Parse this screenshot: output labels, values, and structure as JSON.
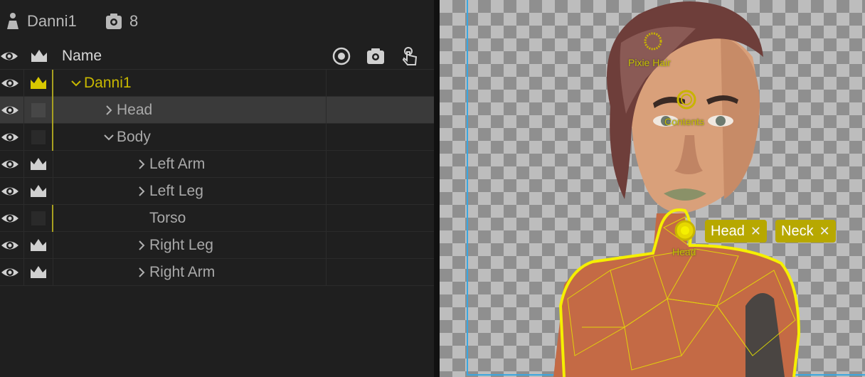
{
  "header": {
    "puppet_name": "Danni1",
    "count": "8"
  },
  "columns": {
    "name": "Name"
  },
  "rows": [
    {
      "label": "Danni1",
      "indent": 0,
      "chevron": "down",
      "crown": "lead",
      "color": "#c8b800"
    },
    {
      "label": "Head",
      "indent": 1,
      "chevron": "right",
      "crown": "none",
      "selected": true
    },
    {
      "label": "Body",
      "indent": 1,
      "chevron": "down",
      "crown": "none"
    },
    {
      "label": "Left Arm",
      "indent": 2,
      "chevron": "right",
      "crown": "white"
    },
    {
      "label": "Left Leg",
      "indent": 2,
      "chevron": "right",
      "crown": "white"
    },
    {
      "label": "Torso",
      "indent": 2,
      "chevron": "none",
      "crown": "none"
    },
    {
      "label": "Right Leg",
      "indent": 2,
      "chevron": "right",
      "crown": "white"
    },
    {
      "label": "Right Arm",
      "indent": 2,
      "chevron": "right",
      "crown": "white"
    }
  ],
  "canvas": {
    "handles": {
      "pixie_hair": "Pixie Hair",
      "contents": "Contents",
      "head": "Head"
    },
    "tags": [
      {
        "label": "Head",
        "close": "✕"
      },
      {
        "label": "Neck",
        "close": "✕"
      }
    ]
  }
}
